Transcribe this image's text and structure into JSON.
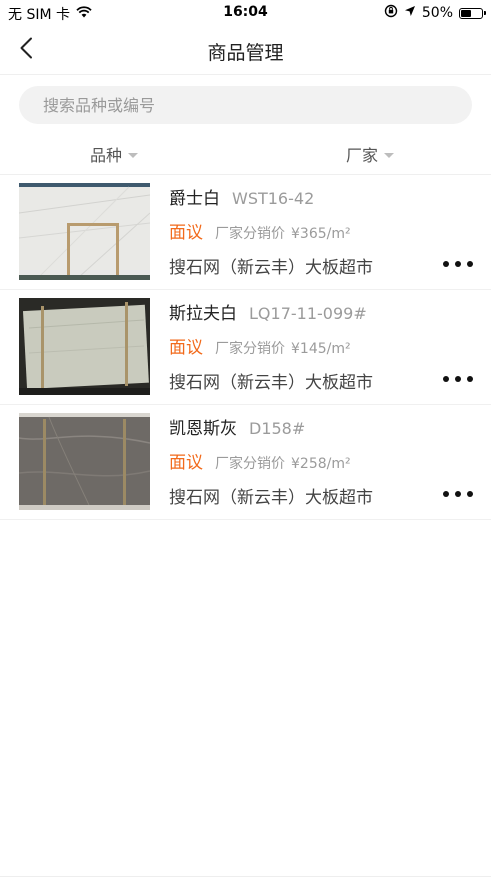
{
  "status_bar": {
    "carrier": "无 SIM 卡",
    "time": "16:04",
    "battery": "50%",
    "battery_level": 0.5,
    "icons": [
      "wifi-icon",
      "orientation-lock-icon",
      "location-icon",
      "battery-icon"
    ]
  },
  "nav": {
    "title": "商品管理",
    "back_icon": "chevron-left-icon"
  },
  "search": {
    "placeholder": "搜索品种或编号",
    "value": ""
  },
  "filters": {
    "variety": "品种",
    "factory": "厂家"
  },
  "products": [
    {
      "name": "爵士白",
      "code": "WST16-42",
      "price_status": "面议",
      "dist_label": "厂家分销价",
      "dist_price": "¥365/m²",
      "supplier": "搜石网（新云丰）大板超市",
      "image": "white-marble-slab"
    },
    {
      "name": "斯拉夫白",
      "code": "LQ17-11-099#",
      "price_status": "面议",
      "dist_label": "厂家分销价",
      "dist_price": "¥145/m²",
      "supplier": "搜石网（新云丰）大板超市",
      "image": "grey-white-marble-slab"
    },
    {
      "name": "凯恩斯灰",
      "code": "D158#",
      "price_status": "面议",
      "dist_label": "厂家分销价",
      "dist_price": "¥258/m²",
      "supplier": "搜石网（新云丰）大板超市",
      "image": "grey-marble-slab"
    }
  ],
  "colors": {
    "accent_orange": "#f26a1b",
    "search_bg": "#f2f2f2",
    "divider": "#efefef"
  }
}
